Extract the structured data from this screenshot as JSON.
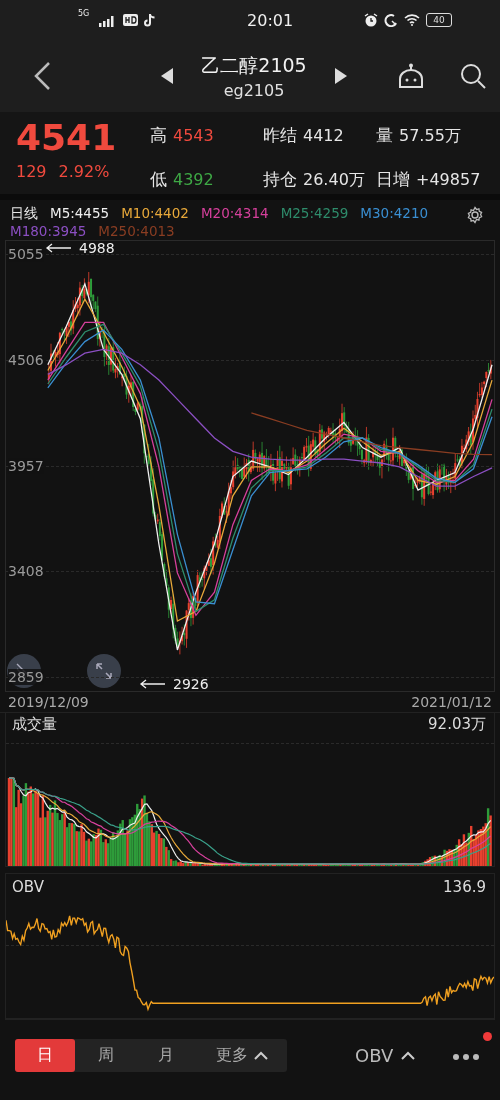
{
  "status_bar": {
    "network": "5G",
    "time": "20:01",
    "battery": "40"
  },
  "header": {
    "title": "乙二醇2105",
    "subtitle": "eg2105"
  },
  "quote": {
    "price": "4541",
    "change": "129",
    "change_pct": "2.92%",
    "color": "#f04a3e",
    "stats": [
      {
        "label": "高",
        "value": "4543",
        "color": "#f04a3e"
      },
      {
        "label": "昨结",
        "value": "4412",
        "color": "#e6e6e6"
      },
      {
        "label": "量",
        "value": "57.55万",
        "color": "#e6e6e6"
      },
      {
        "label": "低",
        "value": "4392",
        "color": "#3ea845"
      },
      {
        "label": "持仓",
        "value": "26.40万",
        "color": "#e6e6e6"
      },
      {
        "label": "日增",
        "value": "+49857",
        "color": "#e6e6e6"
      }
    ]
  },
  "price_chart": {
    "period_label": "日线",
    "high_marker": "4988",
    "low_marker": "2926",
    "start_date": "2019/12/09",
    "end_date": "2021/01/12",
    "chart_data": {
      "type": "line",
      "ylim": [
        2787,
        5122
      ],
      "yticks": [
        2859,
        3408,
        3957,
        4506,
        5055
      ],
      "grid": true,
      "series": [
        {
          "name": "M5:4455",
          "color": "#f0f0f0",
          "values": [
            4480,
            4680,
            4900,
            4560,
            4430,
            4200,
            3550,
            3000,
            3300,
            3550,
            3900,
            3980,
            3950,
            3910,
            4000,
            4100,
            4180,
            4050,
            4000,
            4050,
            3830,
            3880,
            3920,
            4150,
            4480
          ]
        },
        {
          "name": "M10:4402",
          "color": "#e8a93a",
          "values": [
            4450,
            4620,
            4820,
            4650,
            4470,
            4260,
            3750,
            3150,
            3200,
            3450,
            3800,
            3950,
            3950,
            3920,
            3980,
            4070,
            4150,
            4080,
            4010,
            4030,
            3880,
            3860,
            3900,
            4080,
            4400
          ]
        },
        {
          "name": "M20:4314",
          "color": "#d6409c",
          "values": [
            4400,
            4550,
            4700,
            4700,
            4520,
            4330,
            3950,
            3400,
            3180,
            3300,
            3650,
            3880,
            3940,
            3930,
            3960,
            4040,
            4120,
            4100,
            4030,
            4020,
            3930,
            3870,
            3880,
            3990,
            4300
          ]
        },
        {
          "name": "M25:4259",
          "color": "#2e8c6b",
          "values": [
            4380,
            4520,
            4650,
            4690,
            4540,
            4370,
            4030,
            3500,
            3200,
            3260,
            3580,
            3840,
            3930,
            3930,
            3950,
            4020,
            4100,
            4100,
            4040,
            4020,
            3950,
            3880,
            3870,
            3960,
            4250
          ]
        },
        {
          "name": "M30:4210",
          "color": "#3a8fd2",
          "values": [
            4360,
            4490,
            4600,
            4660,
            4560,
            4400,
            4100,
            3600,
            3250,
            3240,
            3520,
            3800,
            3920,
            3930,
            3940,
            4000,
            4080,
            4100,
            4050,
            4020,
            3960,
            3890,
            3870,
            3940,
            4210
          ]
        },
        {
          "name": "M180:3945",
          "color": "#8b4fc2",
          "values": [
            4430,
            4480,
            4540,
            4560,
            4540,
            4480,
            4400,
            4300,
            4200,
            4100,
            4030,
            4000,
            3990,
            3985,
            3985,
            3990,
            3990,
            3980,
            3970,
            3950,
            3900,
            3850,
            3850,
            3900,
            3945
          ]
        },
        {
          "name": "M250:4013",
          "color": "#8a3d22",
          "values": [
            null,
            null,
            null,
            null,
            null,
            null,
            null,
            null,
            null,
            null,
            null,
            4230,
            4200,
            4170,
            4140,
            4120,
            4100,
            4080,
            4060,
            4050,
            4040,
            4030,
            4020,
            4015,
            4013
          ]
        }
      ]
    }
  },
  "volume_panel": {
    "title": "成交量",
    "max": "92.03万"
  },
  "obv_panel": {
    "title": "OBV",
    "value": "136.9"
  },
  "bottom_bar": {
    "periods": [
      {
        "label": "日",
        "selected": true
      },
      {
        "label": "周",
        "selected": false
      },
      {
        "label": "月",
        "selected": false
      },
      {
        "label": "更多",
        "selected": false
      }
    ],
    "indicator": "OBV",
    "notification": true
  }
}
